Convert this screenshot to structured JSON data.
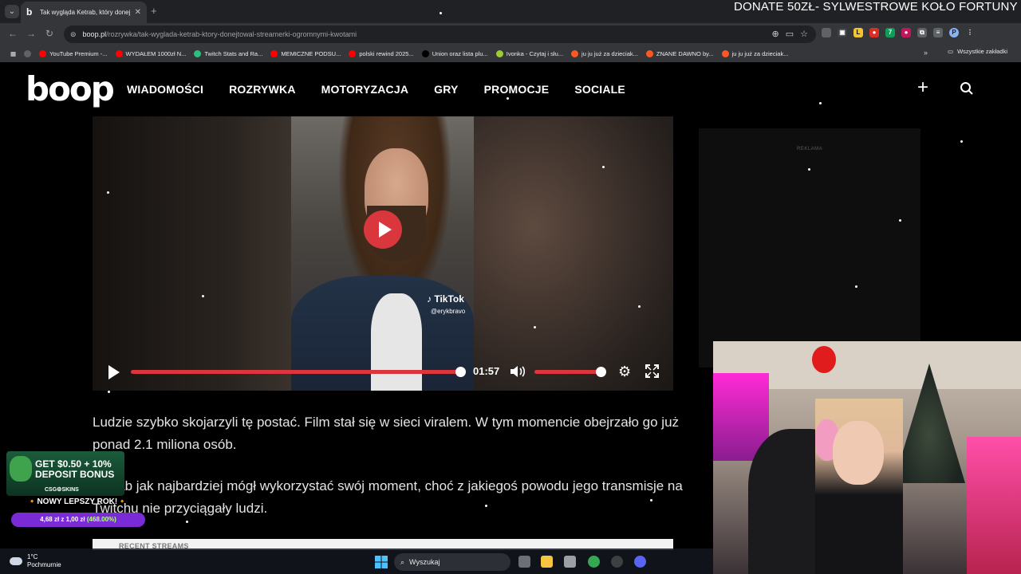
{
  "browser": {
    "tab_title": "Tak wygląda Ketrab, który donej…",
    "tab_close": "✕",
    "new_tab": "+",
    "url_domain": "boop.pl",
    "url_path": "/rozrywka/tak-wyglada-ketrab-ktory-donejtowal-streamerki-ogromnymi-kwotami",
    "bookmarks": [
      {
        "label": "YouTube Premium -...",
        "color": "#ff0000"
      },
      {
        "label": "WYDAŁEM 1000zł N...",
        "color": "#ff0000"
      },
      {
        "label": "Twitch Stats and Ra...",
        "color": "#29c17e"
      },
      {
        "label": "MEMICZNE PODSU...",
        "color": "#ff0000"
      },
      {
        "label": "polski rewind 2025...",
        "color": "#ff0000"
      },
      {
        "label": "Union oraz lista plu...",
        "color": "#000000"
      },
      {
        "label": "Ivonka - Czytaj i słu...",
        "color": "#9acd32"
      },
      {
        "label": "ju ju już za dzieciak...",
        "color": "#ff5722"
      },
      {
        "label": "ZNANE DAWNO by...",
        "color": "#ff5722"
      },
      {
        "label": "ju ju już za dzieciak...",
        "color": "#ff5722"
      }
    ],
    "bookmarks_more": "»",
    "bookmarks_all": "Wszystkie zakładki"
  },
  "overlay": {
    "donate_banner": "DONATE 50ZŁ- SYLWESTROWE KOŁO FORTUNY",
    "casino_line1": "GET $0.50 + 10%",
    "casino_line2": "DEPOSIT BONUS",
    "casino_brand": "CSG⚙SKINS",
    "promo": "🔸NOWY LEPSZY ROK!🔸",
    "odds_prefix": "4,68 zł z 1,00 zł",
    "odds_pct": "(468.00%)"
  },
  "site": {
    "logo": "boop",
    "nav": [
      "WIADOMOŚCI",
      "ROZRYWKA",
      "MOTORYZACJA",
      "GRY",
      "PROMOCJE",
      "SOCIALE"
    ],
    "ad_label": "REKLAMA"
  },
  "video": {
    "watermark": "♪ TikTok",
    "username": "@erykbravo",
    "time": "01:57",
    "progress": 1.0,
    "volume": 1.0
  },
  "article": {
    "paragraph1": "Ludzie szybko skojarzyli tę postać. Film stał się w sieci viralem. W tym momencie obejrzało go już ponad 2.1 miliona osób.",
    "paragraph2": "Ketrab jak najbardziej mógł wykorzystać swój moment, choć z jakiegoś powodu jego transmisje na Twitchu nie przyciągały ludzi.",
    "recent_streams": "RECENT STREAMS"
  },
  "taskbar": {
    "temp": "1°C",
    "weather": "Pochmurnie",
    "search_placeholder": "Wyszukaj"
  }
}
